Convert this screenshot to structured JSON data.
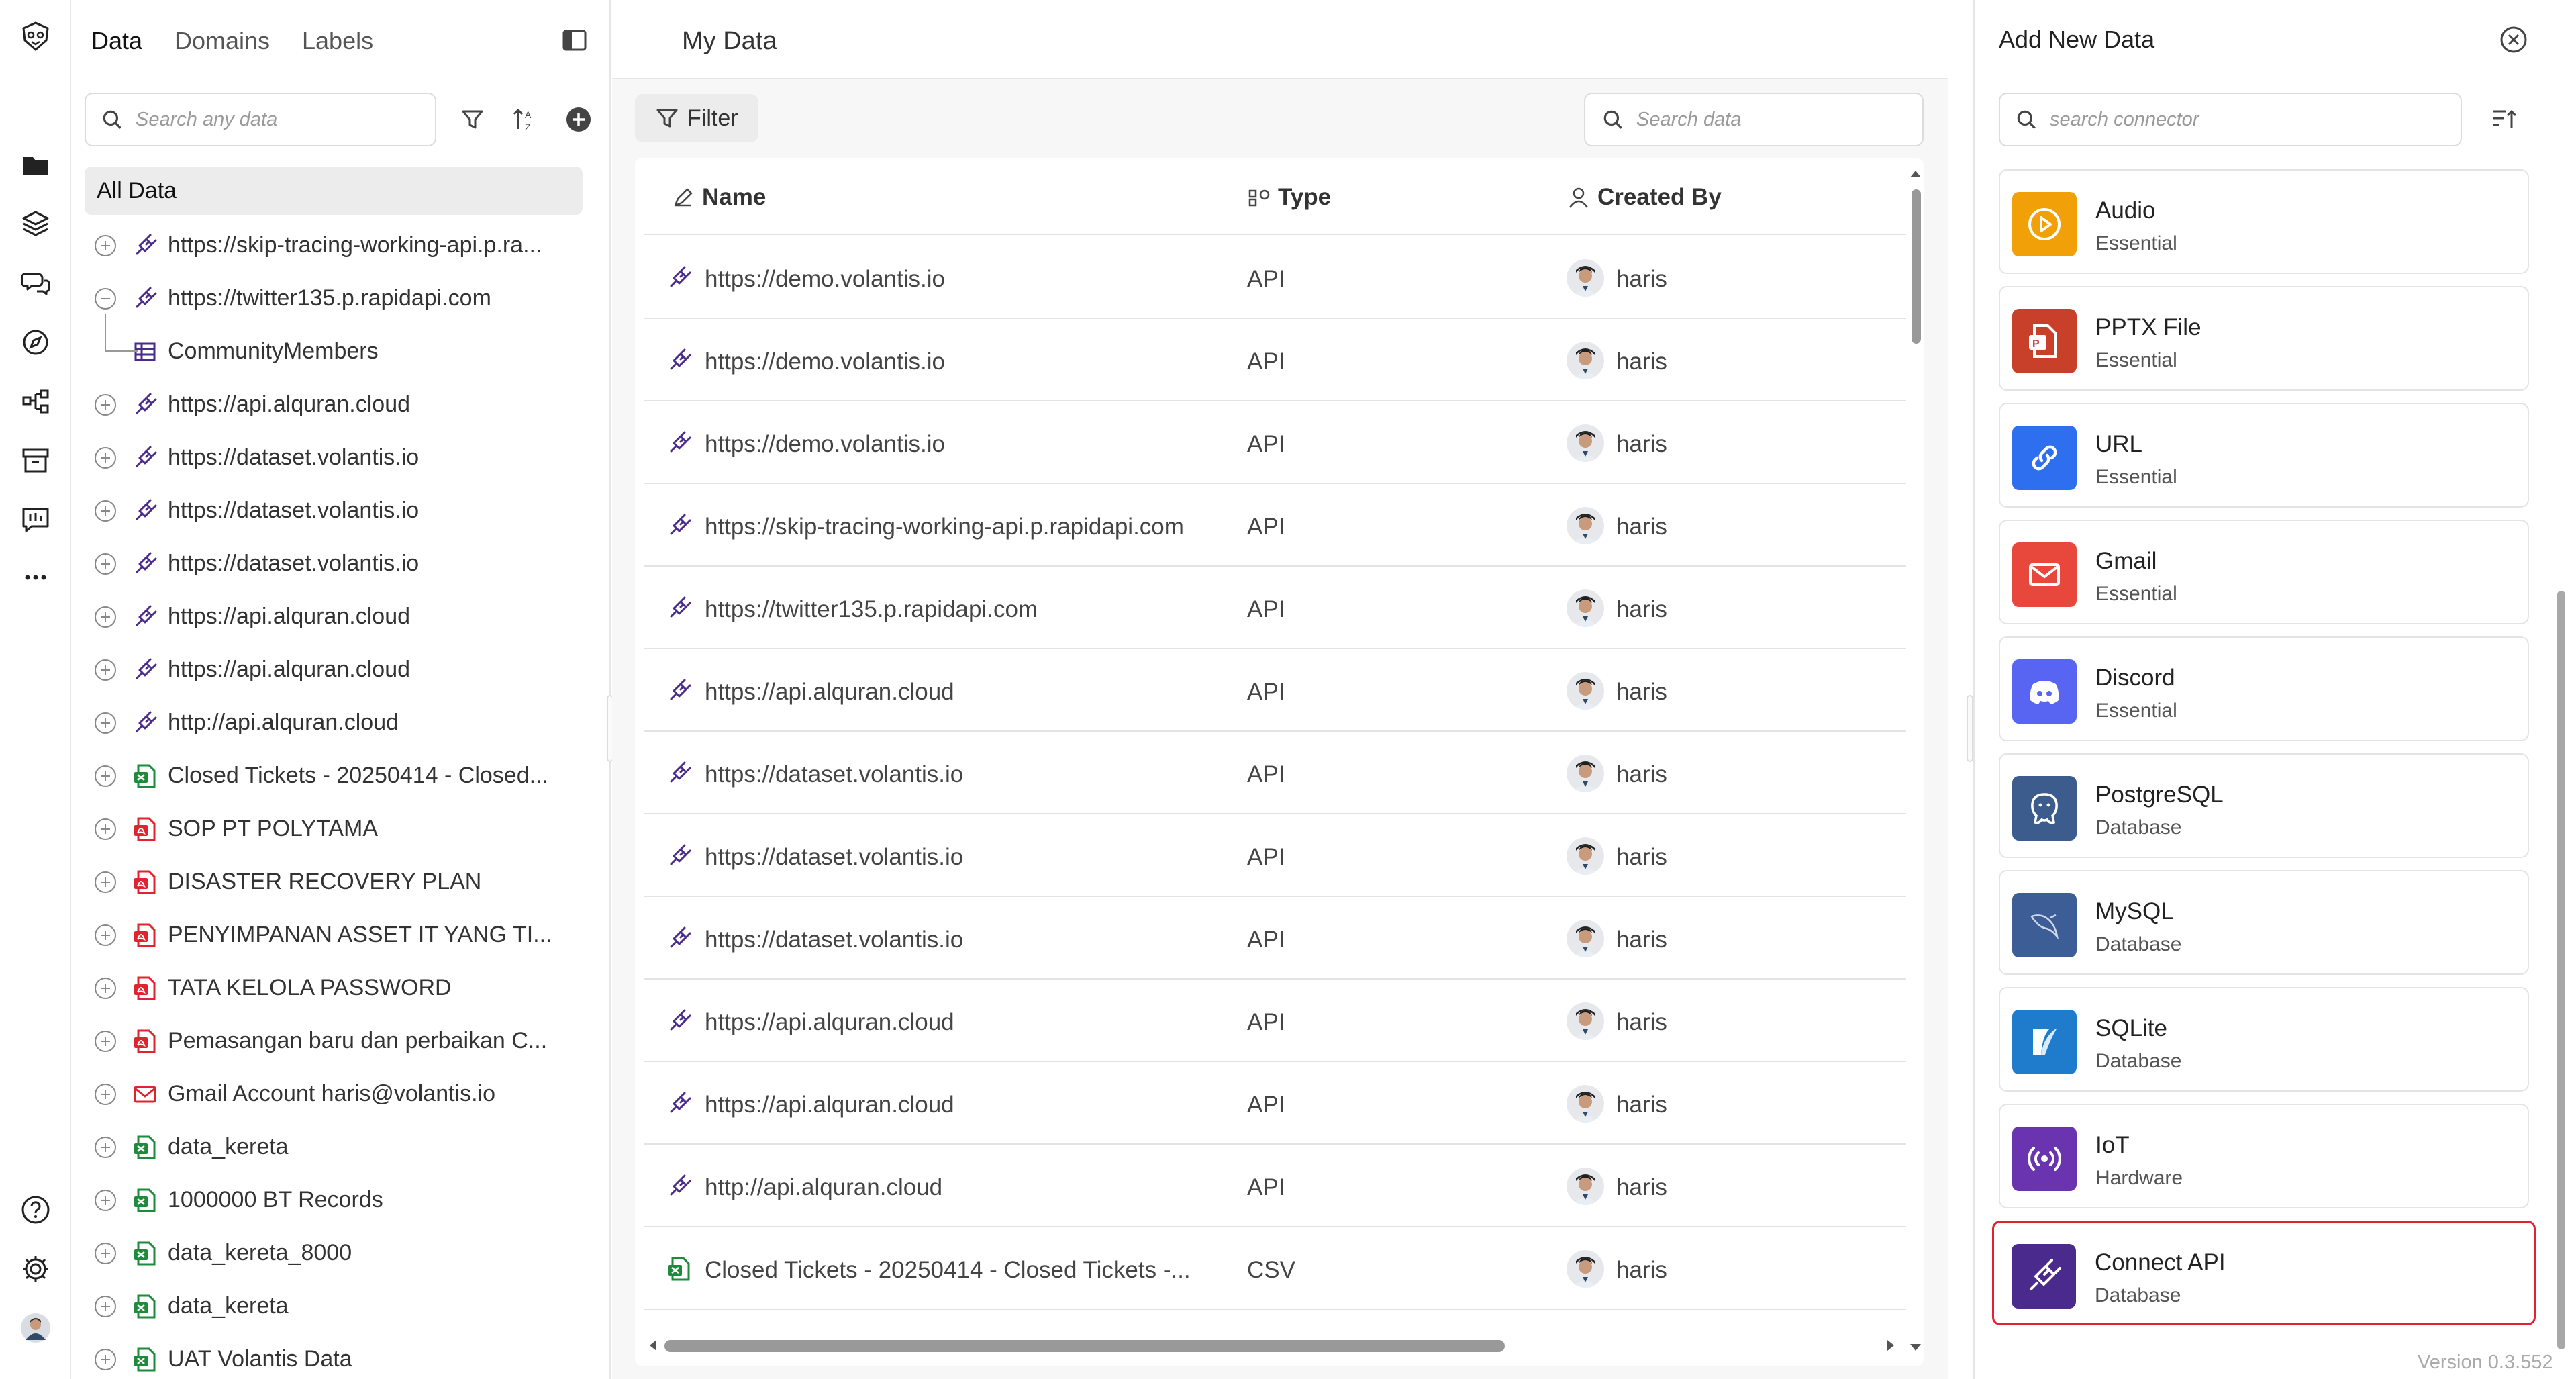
{
  "rail": {
    "items": [
      "logo-icon",
      "data-icon",
      "layers-icon",
      "chat-icon",
      "explore-icon",
      "workflow-icon",
      "archive-icon",
      "feedback-icon",
      "more-icon"
    ],
    "bottom": [
      "help-icon",
      "settings-icon",
      "user-avatar"
    ]
  },
  "left": {
    "tabs": [
      "Data",
      "Domains",
      "Labels"
    ],
    "search_placeholder": "Search any data",
    "all_data_label": "All Data",
    "items": [
      {
        "label": "https://skip-tracing-working-api.p.ra...",
        "type": "api",
        "expanded": false
      },
      {
        "label": "https://twitter135.p.rapidapi.com",
        "type": "api",
        "expanded": true
      },
      {
        "label": "CommunityMembers",
        "type": "table",
        "child": true
      },
      {
        "label": "https://api.alquran.cloud",
        "type": "api"
      },
      {
        "label": "https://dataset.volantis.io",
        "type": "api"
      },
      {
        "label": "https://dataset.volantis.io",
        "type": "api"
      },
      {
        "label": "https://dataset.volantis.io",
        "type": "api"
      },
      {
        "label": "https://api.alquran.cloud",
        "type": "api"
      },
      {
        "label": "https://api.alquran.cloud",
        "type": "api"
      },
      {
        "label": "http://api.alquran.cloud",
        "type": "api"
      },
      {
        "label": "Closed Tickets - 20250414 - Closed...",
        "type": "csv"
      },
      {
        "label": "SOP PT POLYTAMA",
        "type": "pdf"
      },
      {
        "label": "DISASTER RECOVERY PLAN",
        "type": "pdf"
      },
      {
        "label": "PENYIMPANAN ASSET IT YANG TI...",
        "type": "pdf"
      },
      {
        "label": "TATA KELOLA PASSWORD",
        "type": "pdf"
      },
      {
        "label": "Pemasangan baru dan perbaikan C...",
        "type": "pdf"
      },
      {
        "label": "Gmail Account haris@volantis.io",
        "type": "gmail"
      },
      {
        "label": "data_kereta",
        "type": "csv"
      },
      {
        "label": "1000000 BT Records",
        "type": "csv"
      },
      {
        "label": "data_kereta_8000",
        "type": "csv"
      },
      {
        "label": "data_kereta",
        "type": "csv"
      },
      {
        "label": "UAT Volantis Data",
        "type": "csv"
      }
    ]
  },
  "main": {
    "title": "My Data",
    "filter_label": "Filter",
    "search_placeholder": "Search data",
    "columns": [
      "Name",
      "Type",
      "Created By"
    ],
    "rows": [
      {
        "name": "https://demo.volantis.io",
        "type": "API",
        "created_by": "haris",
        "icon": "api"
      },
      {
        "name": "https://demo.volantis.io",
        "type": "API",
        "created_by": "haris",
        "icon": "api"
      },
      {
        "name": "https://demo.volantis.io",
        "type": "API",
        "created_by": "haris",
        "icon": "api"
      },
      {
        "name": "https://skip-tracing-working-api.p.rapidapi.com",
        "type": "API",
        "created_by": "haris",
        "icon": "api"
      },
      {
        "name": "https://twitter135.p.rapidapi.com",
        "type": "API",
        "created_by": "haris",
        "icon": "api"
      },
      {
        "name": "https://api.alquran.cloud",
        "type": "API",
        "created_by": "haris",
        "icon": "api"
      },
      {
        "name": "https://dataset.volantis.io",
        "type": "API",
        "created_by": "haris",
        "icon": "api"
      },
      {
        "name": "https://dataset.volantis.io",
        "type": "API",
        "created_by": "haris",
        "icon": "api"
      },
      {
        "name": "https://dataset.volantis.io",
        "type": "API",
        "created_by": "haris",
        "icon": "api"
      },
      {
        "name": "https://api.alquran.cloud",
        "type": "API",
        "created_by": "haris",
        "icon": "api"
      },
      {
        "name": "https://api.alquran.cloud",
        "type": "API",
        "created_by": "haris",
        "icon": "api"
      },
      {
        "name": "http://api.alquran.cloud",
        "type": "API",
        "created_by": "haris",
        "icon": "api"
      },
      {
        "name": "Closed Tickets - 20250414 - Closed Tickets -...",
        "type": "CSV",
        "created_by": "haris",
        "icon": "csv"
      }
    ]
  },
  "right": {
    "title": "Add New Data",
    "search_placeholder": "search connector",
    "connectors": [
      {
        "name": "Audio",
        "category": "Essential",
        "icon": "audio-icon",
        "color": "#f2a007"
      },
      {
        "name": "PPTX File",
        "category": "Essential",
        "icon": "pptx-icon",
        "color": "#c8402a"
      },
      {
        "name": "URL",
        "category": "Essential",
        "icon": "link-icon",
        "color": "#2e6ff0"
      },
      {
        "name": "Gmail",
        "category": "Essential",
        "icon": "gmail-icon",
        "color": "#e8473c"
      },
      {
        "name": "Discord",
        "category": "Essential",
        "icon": "discord-icon",
        "color": "#5865f2"
      },
      {
        "name": "PostgreSQL",
        "category": "Database",
        "icon": "postgresql-icon",
        "color": "#3b5c8c"
      },
      {
        "name": "MySQL",
        "category": "Database",
        "icon": "mysql-icon",
        "color": "#3d5d96"
      },
      {
        "name": "SQLite",
        "category": "Database",
        "icon": "sqlite-icon",
        "color": "#1f7ccc"
      },
      {
        "name": "IoT",
        "category": "Hardware",
        "icon": "iot-icon",
        "color": "#6a34b0"
      },
      {
        "name": "Connect API",
        "category": "Database",
        "icon": "plug-icon",
        "color": "#4a2a8c",
        "selected": true
      }
    ],
    "version": "Version 0.3.552"
  }
}
